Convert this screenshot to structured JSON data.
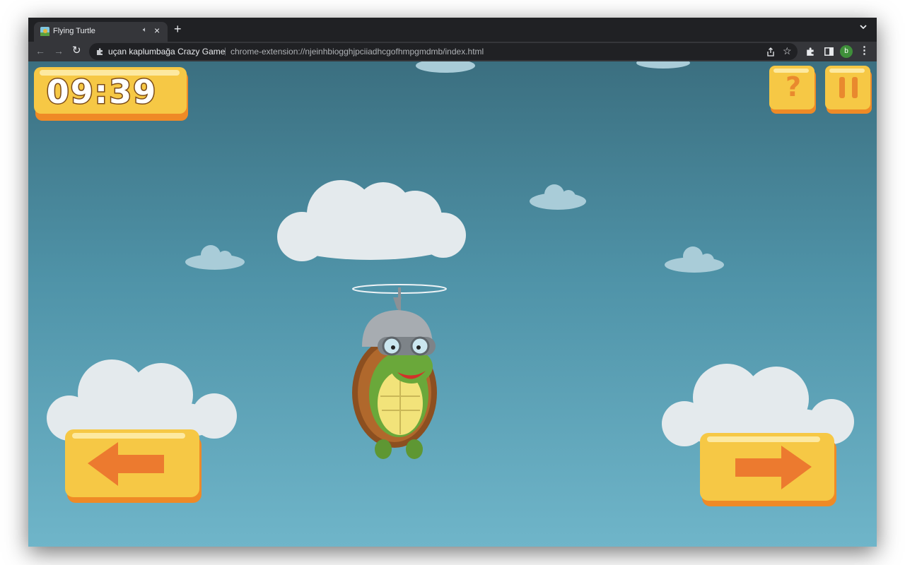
{
  "browser": {
    "tab": {
      "title": "Flying Turtle"
    },
    "new_tab_symbol": "+",
    "omnibox": {
      "site_name": "uçan kaplumbağa Crazy Game",
      "url": "chrome-extension://njeinhbiogghjpciiadhcgofhmpgmdmb/index.html"
    },
    "profile_initial": "b",
    "profile_color": "#3f8f3a"
  },
  "game": {
    "title": "Flying Turtle",
    "timer": "09:39",
    "help_label": "?",
    "controls": {
      "left_icon": "arrow-left-icon",
      "right_icon": "arrow-right-icon",
      "pause_icon": "pause-icon"
    },
    "colors": {
      "button_yellow": "#f6c845",
      "arrow_orange": "#ec7a2f",
      "sky_top": "#3b6f80",
      "sky_bottom": "#6fb5c9"
    }
  }
}
